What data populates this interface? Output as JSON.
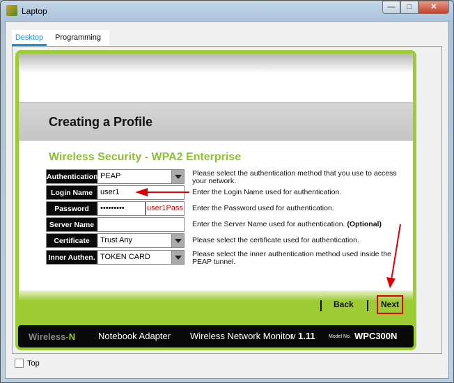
{
  "window": {
    "title": "Laptop",
    "buttons": [
      "minimize",
      "maximize",
      "close"
    ]
  },
  "tabs": [
    {
      "label": "Desktop",
      "active": true
    },
    {
      "label": "Programming",
      "active": false
    }
  ],
  "page": {
    "header": "Creating a Profile",
    "section": "Wireless Security - WPA2 Enterprise",
    "fields": [
      {
        "label": "Authentication",
        "value": "PEAP",
        "type": "select",
        "desc": "Please select the authentication method that you use to access your network."
      },
      {
        "label": "Login Name",
        "value": "user1",
        "type": "text",
        "desc": "Enter the Login Name used for authentication."
      },
      {
        "label": "Password",
        "value": "•••••••••",
        "type": "password",
        "annotation": "user1Pass",
        "desc": "Enter the Password used for authentication."
      },
      {
        "label": "Server Name",
        "value": "",
        "type": "text",
        "desc": "Enter the Server Name used for authentication.",
        "desc_bold": "(Optional)"
      },
      {
        "label": "Certificate",
        "value": "Trust Any",
        "type": "select",
        "desc": "Please select the certificate used for authentication."
      },
      {
        "label": "Inner Authen.",
        "value": "TOKEN CARD",
        "type": "select",
        "desc": "Please select the inner authentication method used inside the PEAP tunnel."
      }
    ],
    "back": "Back",
    "next": "Next",
    "footer": {
      "brand1": "Wireless-",
      "brand2": "N",
      "product": "Notebook Adapter",
      "monitor": "Wireless Network Monitor",
      "version_prefix": "v",
      "version": "1.11",
      "model_label": "Model No.",
      "model": "WPC300N"
    }
  },
  "colors": {
    "accent": "#9ccb34",
    "annotation": "#e00000",
    "tab_active": "#1c90d8"
  },
  "top_checkbox": {
    "label": "Top",
    "checked": false
  }
}
